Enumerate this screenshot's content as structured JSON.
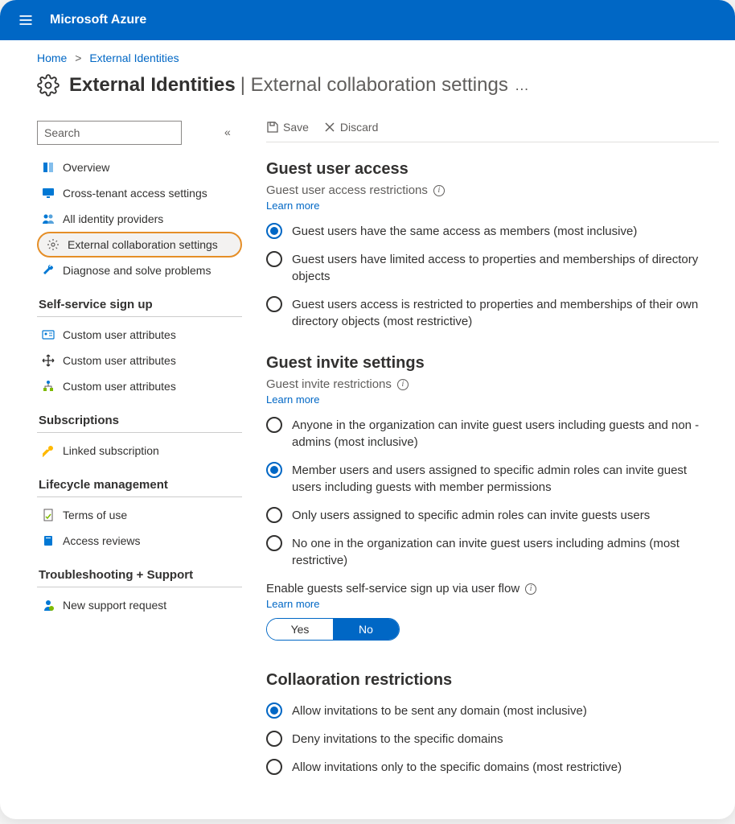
{
  "brand": "Microsoft Azure",
  "breadcrumb": {
    "home": "Home",
    "current": "External Identities"
  },
  "page": {
    "title_main": "External Identities",
    "title_sub": "External collaboration settings"
  },
  "toolbar": {
    "save": "Save",
    "discard": "Discard"
  },
  "sidebar": {
    "search_placeholder": "Search",
    "items_top": [
      {
        "label": "Overview"
      },
      {
        "label": "Cross-tenant access settings"
      },
      {
        "label": "All identity providers"
      },
      {
        "label": "External collaboration settings"
      },
      {
        "label": "Diagnose and solve problems"
      }
    ],
    "section1": "Self-service sign up",
    "items_ss": [
      {
        "label": "Custom user attributes"
      },
      {
        "label": "Custom user attributes"
      },
      {
        "label": "Custom user attributes"
      }
    ],
    "section2": "Subscriptions",
    "items_sub": [
      {
        "label": "Linked subscription"
      }
    ],
    "section3": "Lifecycle management",
    "items_life": [
      {
        "label": "Terms of use"
      },
      {
        "label": "Access reviews"
      }
    ],
    "section4": "Troubleshooting + Support",
    "items_ts": [
      {
        "label": "New support request"
      }
    ]
  },
  "guest_access": {
    "title": "Guest user access",
    "sub": "Guest user access restrictions",
    "learn": "Learn more",
    "options": [
      "Guest users have the same access as members (most inclusive)",
      "Guest users have limited access to properties and memberships of directory objects",
      "Guest users access is restricted to properties and memberships of their own directory objects (most restrictive)"
    ],
    "selected": 0
  },
  "guest_invite": {
    "title": "Guest invite settings",
    "sub": "Guest invite restrictions",
    "learn": "Learn more",
    "options": [
      "Anyone in the organization can invite guest users including guests and non -admins (most inclusive)",
      "Member users and users assigned to specific admin roles can invite guest users including guests with member permissions",
      "Only users assigned to specific admin roles can invite guests users",
      "No one in the organization can invite guest users including admins (most restrictive)"
    ],
    "selected": 1,
    "self_service_label": "Enable guests self-service sign up via user flow",
    "self_service_learn": "Learn more",
    "toggle": {
      "yes": "Yes",
      "no": "No",
      "value": "No"
    }
  },
  "collab": {
    "title": "Collaoration restrictions",
    "options": [
      "Allow invitations to be sent any domain (most inclusive)",
      "Deny invitations to the specific domains",
      "Allow invitations only to the specific domains (most restrictive)"
    ],
    "selected": 0
  }
}
